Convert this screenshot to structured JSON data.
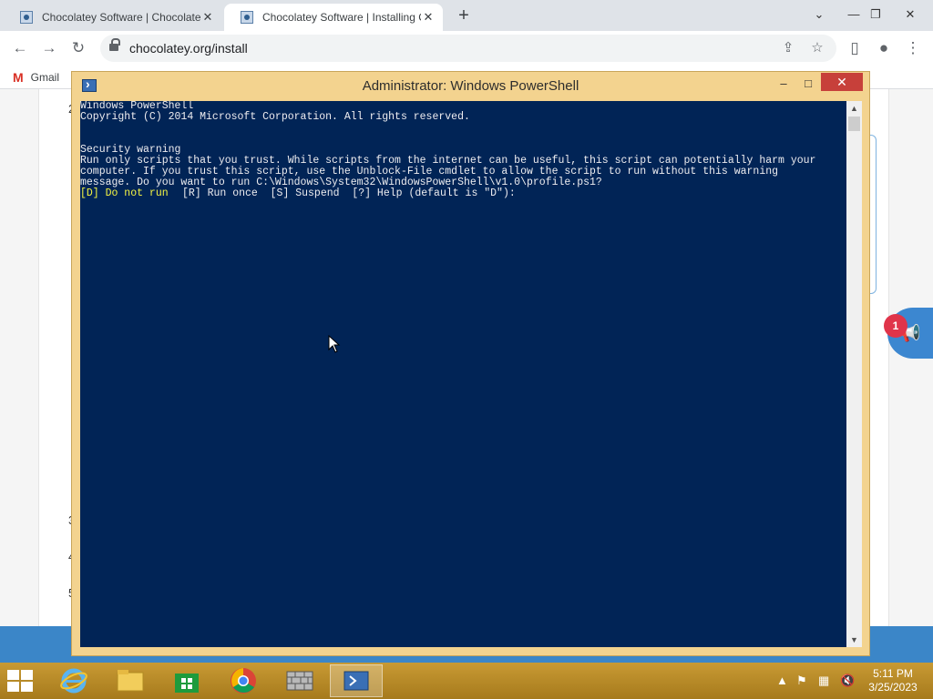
{
  "browser": {
    "tabs": [
      {
        "title": "Chocolatey Software | Chocolatey"
      },
      {
        "title": "Chocolatey Software | Installing C"
      }
    ],
    "new_tab": "+",
    "url": "chocolatey.org/install",
    "bookmarks": [
      {
        "label": "Gmail"
      }
    ]
  },
  "webpage": {
    "step_numbers": [
      "2",
      "3",
      "4",
      "5"
    ],
    "notification_count": "1"
  },
  "powershell": {
    "title": "Administrator: Windows PowerShell",
    "lines": [
      "Windows PowerShell",
      "Copyright (C) 2014 Microsoft Corporation. All rights reserved.",
      "",
      "",
      "Security warning",
      "Run only scripts that you trust. While scripts from the internet can be useful, this script can potentially harm your",
      "computer. If you trust this script, use the Unblock-File cmdlet to allow the script to run without this warning",
      "message. Do you want to run C:\\Windows\\System32\\WindowsPowerShell\\v1.0\\profile.ps1?"
    ],
    "prompt_choice_default": "[D] Do not run  ",
    "prompt_rest": "[R] Run once  [S] Suspend  [?] Help (default is \"D\"):"
  },
  "taskbar": {
    "time": "5:11 PM",
    "date": "3/25/2023",
    "colors": {
      "accent": "#b78a28",
      "console_bg": "#012456"
    }
  }
}
